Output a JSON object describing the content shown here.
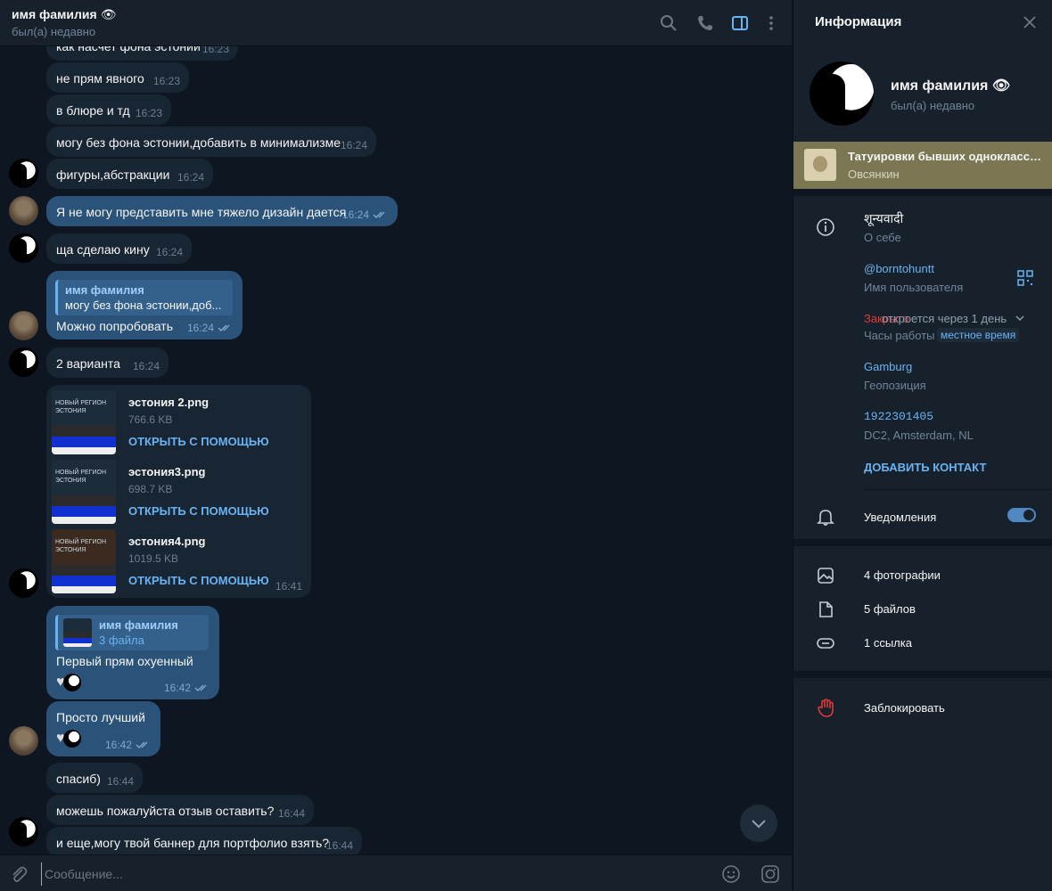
{
  "header": {
    "name": "имя фамилия",
    "name_emoji": "👁",
    "status": "был(а) недавно"
  },
  "messages": [
    {
      "text": "как насчет фона эстонии",
      "time": "16:23"
    },
    {
      "text": "не прям явного",
      "time": "16:23"
    },
    {
      "text": "в блюре и тд",
      "time": "16:23"
    },
    {
      "text": "могу без фона эстонии,добавить в минимализме",
      "time": "16:24"
    },
    {
      "text": "фигуры,абстракции",
      "time": "16:24"
    },
    {
      "text": "Я не могу представить мне тяжело дизайн дается",
      "time": "16:24"
    },
    {
      "text": "ща сделаю кину",
      "time": "16:24"
    },
    {
      "reply_name": "имя фамилия",
      "reply_text": "могу без фона эстонии,доб...",
      "text": "Можно попробовать",
      "time": "16:24"
    },
    {
      "text": "2 варианта",
      "time": "16:24"
    },
    {
      "text": "Первый прям охуенный",
      "reply_name": "имя фамилия",
      "reply_text": "3 файла",
      "time": "16:42"
    },
    {
      "text": "Просто лучший",
      "time": "16:42"
    },
    {
      "text": "спасиб)",
      "time": "16:44"
    },
    {
      "text": "можешь пожалуйста отзыв оставить?",
      "time": "16:44"
    },
    {
      "text": "и еще,могу твой баннер для портфолио взять?",
      "time": "16:44"
    }
  ],
  "files": [
    {
      "name": "эстония 2.png",
      "size": "766.6 KB",
      "action": "ОТКРЫТЬ С ПОМОЩЬЮ",
      "thumb_caption": "НОВЫЙ РЕГИОН ЭСТОНИЯ"
    },
    {
      "name": "эстония3.png",
      "size": "698.7 KB",
      "action": "ОТКРЫТЬ С ПОМОЩЬЮ",
      "thumb_caption": "НОВЫЙ РЕГИОН ЭСТОНИЯ"
    },
    {
      "name": "эстония4.png",
      "size": "1019.5 KB",
      "action": "ОТКРЫТЬ С ПОМОЩЬЮ",
      "thumb_caption": "НОВЫЙ РЕГИОН ЭСТОНИЯ"
    }
  ],
  "files_time": "16:41",
  "composer": {
    "placeholder": "Сообщение..."
  },
  "panel": {
    "title": "Информация",
    "name": "имя фамилия",
    "name_emoji": "👁",
    "status": "был(а) недавно",
    "pinned": {
      "title": "Татуировки бывших одноклассников",
      "subtitle": "Овсянкин"
    },
    "bio_value": "शून्यवादी",
    "bio_label": "О себе",
    "username_value": "@borntohuntt",
    "username_label": "Имя пользователя",
    "hours_closed": "Закрыто",
    "hours_opens": "откроется через 1 день",
    "hours_label": "Часы работы",
    "hours_local": "местное время",
    "location_value": "Gamburg",
    "location_label": "Геопозиция",
    "id_value": "1922301405",
    "id_label": "DC2, Amsterdam, NL",
    "add_contact": "ДОБАВИТЬ КОНТАКТ",
    "notifications": "Уведомления",
    "photos": "4 фотографии",
    "files": "5 файлов",
    "links": "1 ссылка",
    "block": "Заблокировать"
  },
  "colors": {
    "bg": "#0e1621",
    "panel": "#17212b",
    "incoming": "#182533",
    "outgoing": "#2b5278",
    "accent": "#6ab3f3",
    "danger": "#e53935",
    "pinned_bg": "#7a7752"
  }
}
